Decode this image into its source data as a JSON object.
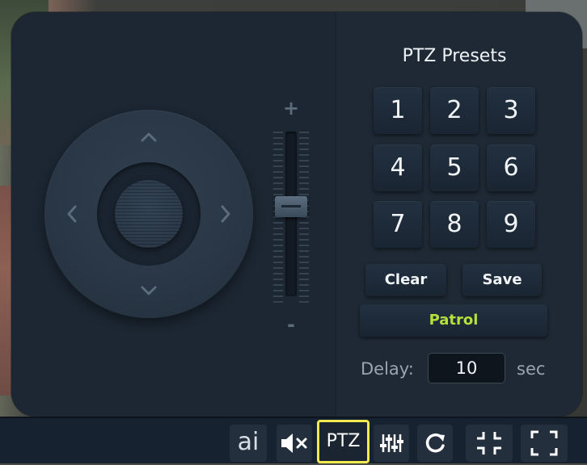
{
  "dpad": {
    "up_icon": "chevron-up-icon",
    "down_icon": "chevron-down-icon",
    "left_icon": "chevron-left-icon",
    "right_icon": "chevron-right-icon"
  },
  "zoom": {
    "plus_label": "+",
    "minus_label": "-",
    "level": 0.55
  },
  "presets": {
    "title": "PTZ Presets",
    "buttons": [
      "1",
      "2",
      "3",
      "4",
      "5",
      "6",
      "7",
      "8",
      "9"
    ],
    "clear_label": "Clear",
    "save_label": "Save",
    "patrol_label": "Patrol",
    "delay_label": "Delay:",
    "delay_value": "10",
    "delay_unit": "sec"
  },
  "toolbar": {
    "ai_label": "ai",
    "mute_icon": "speaker-muted-icon",
    "ptz_label": "PTZ",
    "settings_icon": "sliders-icon",
    "refresh_icon": "refresh-icon",
    "exit_fullscreen_icon": "exit-fullscreen-icon",
    "fullscreen_icon": "fullscreen-icon"
  },
  "colors": {
    "accent_patrol": "#b5e03a",
    "active_highlight": "#f2e94e",
    "panel_bg": "#1c2733"
  }
}
